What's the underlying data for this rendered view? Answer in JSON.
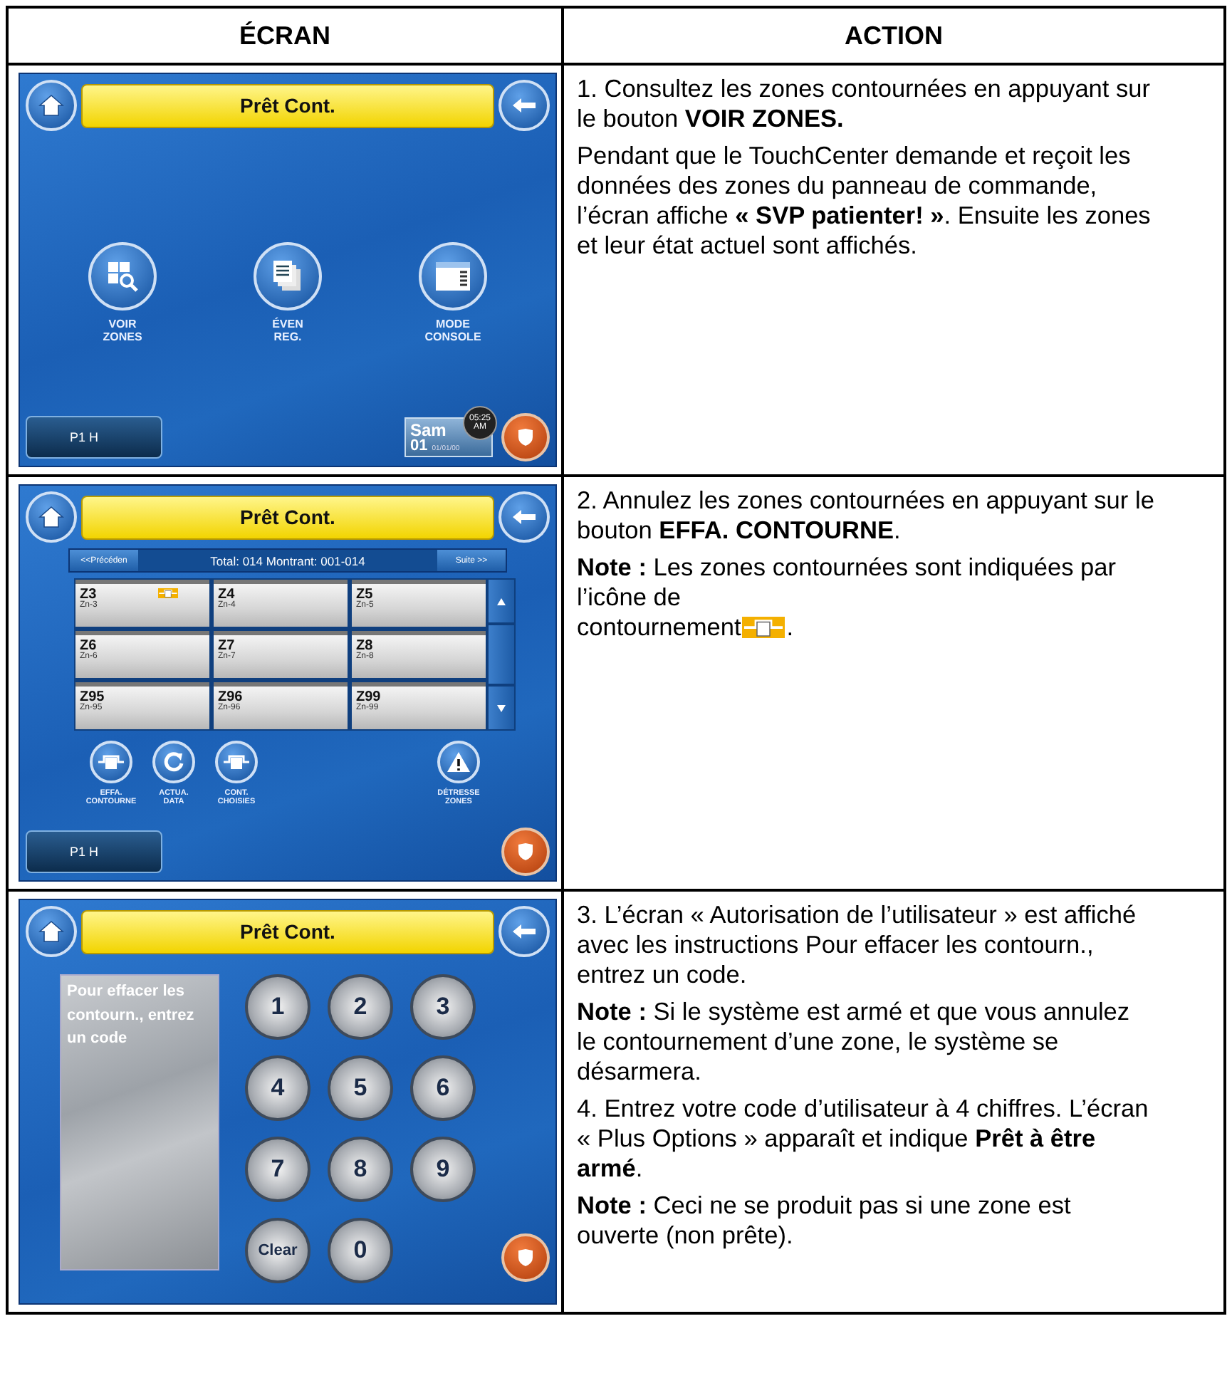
{
  "table": {
    "columns": [
      "ÉCRAN",
      "ACTION"
    ],
    "rows": [
      {
        "screen": {
          "kind": "menu",
          "title": "Prêt Cont.",
          "buttons": [
            {
              "kind": "zones",
              "lines": [
                "VOIR",
                "ZONES"
              ]
            },
            {
              "kind": "events",
              "lines": [
                "ÉVEN",
                "REG."
              ]
            },
            {
              "kind": "console",
              "lines": [
                "MODE",
                "CONSOLE"
              ]
            }
          ],
          "partition": "P1 H",
          "clock": {
            "day": "Sam",
            "day_number": "01",
            "time": "05:25",
            "ampm": "AM",
            "date": "01/01/00"
          }
        },
        "action": [
          {
            "text": "1.  Consultez les zones contournées en appuyant sur le bouton **VOIR ZONES.**"
          },
          {
            "text": "Pendant que le TouchCenter demande et reçoit les données des zones du panneau de commande, l’écran affiche **« SVP patienter! »**. Ensuite les zones et leur état actuel sont affichés."
          }
        ]
      },
      {
        "screen": {
          "kind": "zones",
          "title": "Prêt Cont.",
          "previous": "<<Précéden",
          "summary": "Total: 014  Montrant: 001-014",
          "next": "Suite >>",
          "zones": [
            {
              "id": "Z3",
              "name": "Zn-3",
              "bypassed": true
            },
            {
              "id": "Z4",
              "name": "Zn-4",
              "bypassed": false
            },
            {
              "id": "Z5",
              "name": "Zn-5",
              "bypassed": false
            },
            {
              "id": "Z6",
              "name": "Zn-6",
              "bypassed": false
            },
            {
              "id": "Z7",
              "name": "Zn-7",
              "bypassed": false
            },
            {
              "id": "Z8",
              "name": "Zn-8",
              "bypassed": false
            },
            {
              "id": "Z95",
              "name": "Zn-95",
              "bypassed": false
            },
            {
              "id": "Z96",
              "name": "Zn-96",
              "bypassed": false
            },
            {
              "id": "Z99",
              "name": "Zn-99",
              "bypassed": false
            }
          ],
          "actions": [
            {
              "kind": "bypass",
              "lines": [
                "EFFA.",
                "CONTOURNE"
              ]
            },
            {
              "kind": "refresh",
              "lines": [
                "ACTUA.",
                "DATA"
              ]
            },
            {
              "kind": "bypass",
              "lines": [
                "CONT.",
                "CHOISIES"
              ]
            },
            {
              "kind": "warning",
              "lines": [
                "DÉTRESSE",
                "ZONES"
              ]
            }
          ],
          "partition": "P1 H"
        },
        "action": [
          {
            "text": "2.  Annulez les zones contournées en appuyant sur le bouton **EFFA. CONTOURNE**."
          },
          {
            "text": "**Note :** Les zones contournées sont indiquées par l’icône de",
            "icon_line": "contournement",
            "tail": "."
          }
        ]
      },
      {
        "screen": {
          "kind": "keypad",
          "title": "Prêt Cont.",
          "prompt": "Pour effacer les contourn., entrez un code",
          "keys": [
            "1",
            "2",
            "3",
            "4",
            "5",
            "6",
            "7",
            "8",
            "9",
            "Clear",
            "0"
          ]
        },
        "action": [
          {
            "text": "3. L’écran « Autorisation de l’utilisateur » est affiché avec les instructions Pour effacer les contourn., entrez un code."
          },
          {
            "text": "**Note :** Si le système est armé et que vous annulez le contournement d’une zone, le système se désarmera."
          },
          {
            "text": "4. Entrez votre code d’utilisateur à 4 chiffres.  L’écran « Plus Options » apparaît et indique **Prêt à être armé**."
          },
          {
            "text": "**Note :** Ceci ne se produit pas si une zone est ouverte (non prête)."
          }
        ]
      }
    ]
  }
}
